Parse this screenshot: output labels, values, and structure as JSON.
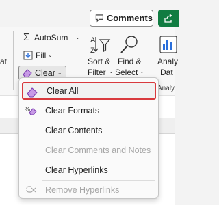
{
  "header": {
    "comments_label": "Comments",
    "icons": [
      "comment-icon",
      "share-icon"
    ]
  },
  "ribbon": {
    "left_partial_label": "at",
    "autosum_label": "AutoSum",
    "fill_label": "Fill",
    "clear_label": "Clear",
    "sort_filter_label_line1": "Sort &",
    "sort_filter_label_line2": "Filter",
    "find_select_label_line1": "Find &",
    "find_select_label_line2": "Select",
    "analyze_label_line1": "Analy",
    "analyze_label_line2": "Dat",
    "group_label_partial": "Analy"
  },
  "clear_menu": {
    "items": [
      {
        "label": "Clear All",
        "icon": "eraser-icon",
        "state": "selected"
      },
      {
        "label": "Clear Formats",
        "icon": "clear-formats-icon",
        "state": "enabled"
      },
      {
        "label": "Clear Contents",
        "icon": "",
        "state": "enabled"
      },
      {
        "label": "Clear Comments and Notes",
        "icon": "",
        "state": "disabled"
      },
      {
        "label": "Clear Hyperlinks",
        "icon": "",
        "state": "enabled"
      },
      {
        "label": "Remove Hyperlinks",
        "icon": "remove-link-icon",
        "state": "disabled"
      }
    ]
  },
  "colors": {
    "accent_green": "#107c41",
    "selection_border": "#d8393d",
    "eraser_purple": "#9b4fc9"
  }
}
